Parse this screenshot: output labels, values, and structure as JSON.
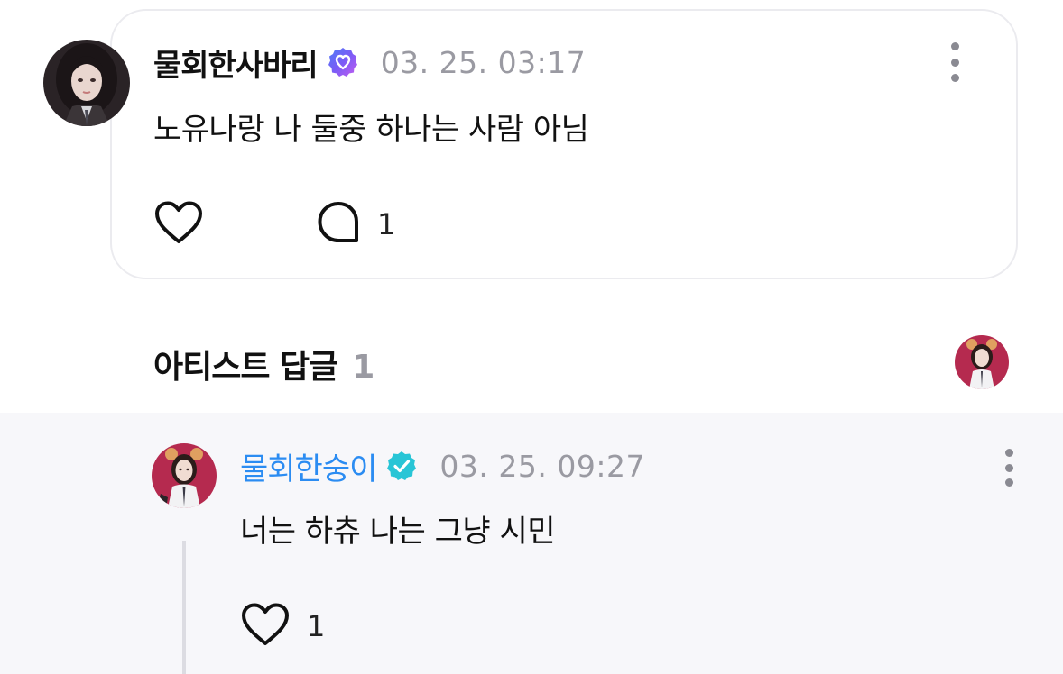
{
  "post": {
    "author": "물회한사바리",
    "verified_badge_icon": "verified-heart-badge-icon",
    "timestamp": "03. 25. 03:17",
    "text": "노유나랑 나 둘중 하나는 사람 아님",
    "like_icon": "heart-icon",
    "comment_icon": "comment-bubble-icon",
    "comment_count": "1",
    "badge_gradient": [
      "#5b6cf5",
      "#8b5cf6",
      "#c45cf0"
    ]
  },
  "artist_replies": {
    "title": "아티스트 답글",
    "count": "1"
  },
  "reply": {
    "author": "물회한숭이",
    "verified_badge_icon": "verified-check-badge-icon",
    "timestamp": "03. 25. 09:27",
    "text": "너는 하츄 나는 그냥 시민",
    "like_icon": "heart-icon",
    "like_count": "1",
    "author_color": "#2b8cf2",
    "badge_color": "#28c5d6"
  }
}
